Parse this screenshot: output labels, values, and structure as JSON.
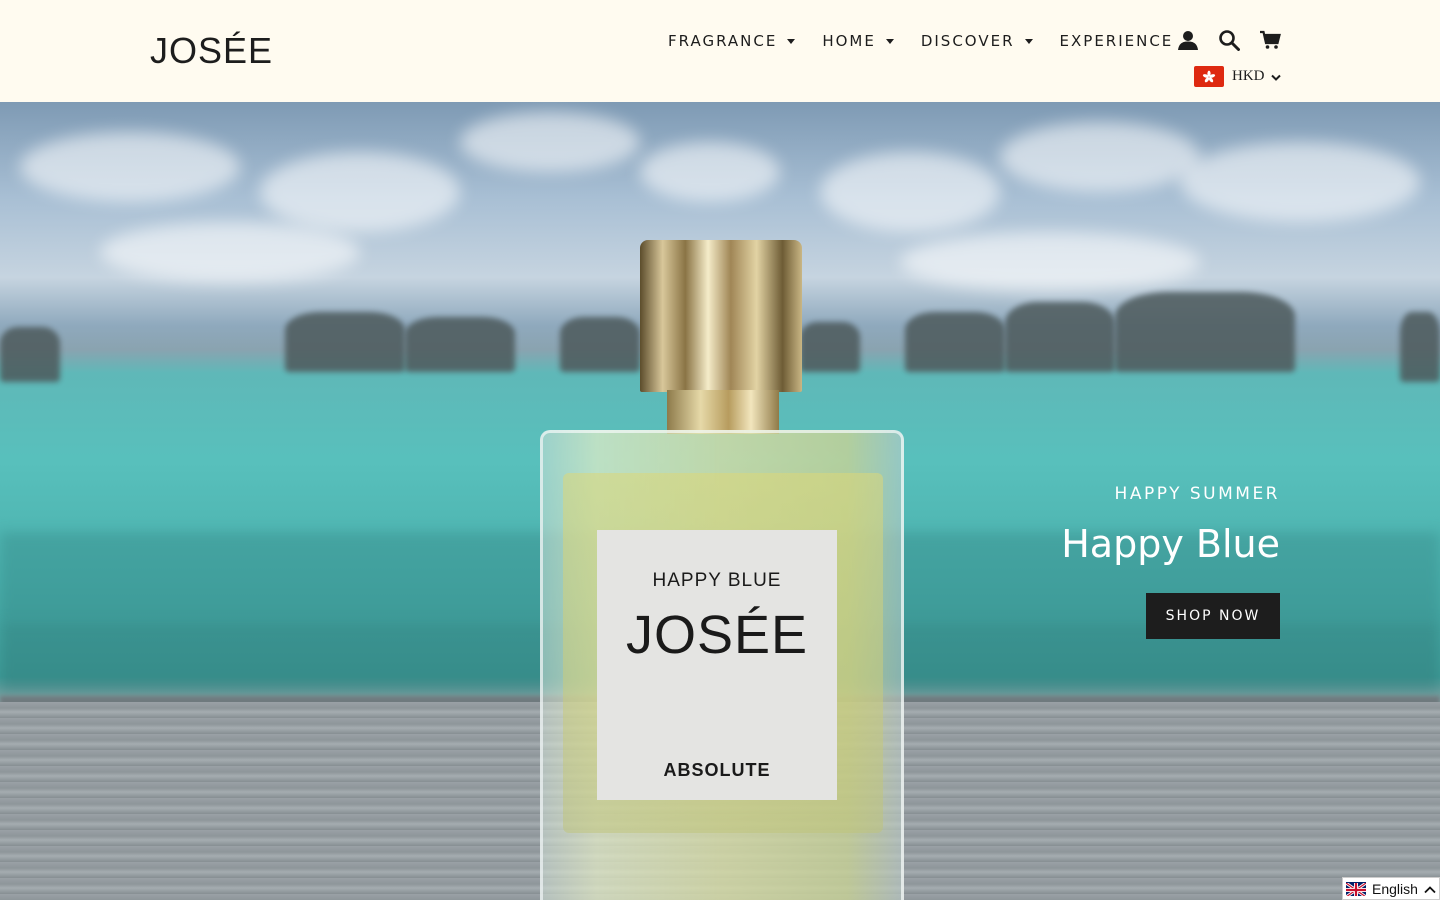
{
  "header": {
    "logo": "JOSÉE",
    "nav": [
      {
        "label": "FRAGRANCE",
        "has_dropdown": true
      },
      {
        "label": "HOME",
        "has_dropdown": true
      },
      {
        "label": "DISCOVER",
        "has_dropdown": true
      },
      {
        "label": "EXPERIENCE",
        "has_dropdown": false
      }
    ],
    "icons": [
      "account-icon",
      "search-icon",
      "cart-icon"
    ],
    "currency": {
      "flag": "hong-kong-flag-icon",
      "code": "HKD"
    }
  },
  "hero": {
    "eyebrow": "HAPPY SUMMER",
    "headline": "Happy Blue",
    "cta_label": "SHOP NOW",
    "product_label": {
      "top": "HAPPY BLUE",
      "brand": "JOSÉE",
      "bottom": "ABSOLUTE"
    }
  },
  "language_switcher": {
    "label": "English",
    "flag": "uk-flag-icon"
  },
  "colors": {
    "header_bg": "#fffbf0",
    "text_dark": "#1d1d1d",
    "button_bg": "#1d1d1d",
    "hero_text": "#ffffff",
    "sea": "#58c0bc"
  }
}
